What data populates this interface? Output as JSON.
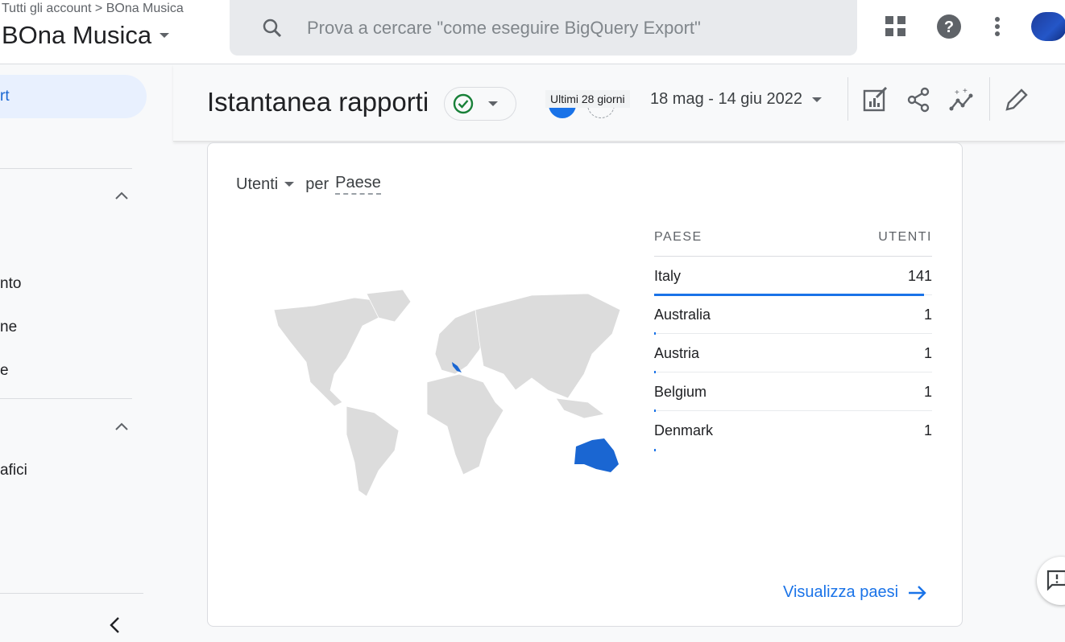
{
  "header": {
    "breadcrumb": "Tutti gli account > BOna Musica",
    "property_name": "BOna Musica",
    "search_placeholder": "Prova a cercare \"come eseguire BigQuery Export\"",
    "icons": [
      "apps-icon",
      "help-icon",
      "more-vert-icon",
      "account-avatar"
    ]
  },
  "sidebar": {
    "items": [
      {
        "label": "rt",
        "active": true
      },
      {
        "label": "nto"
      },
      {
        "label": "ne"
      },
      {
        "label": "e"
      },
      {
        "label": "afici"
      }
    ]
  },
  "toolbar": {
    "title": "Istantanea rapporti",
    "date_chip": "Ultimi 28 giorni",
    "date_range": "18 mag - 14 giu 2022",
    "icons": [
      "customize-report-icon",
      "share-icon",
      "insights-icon",
      "edit-icon"
    ]
  },
  "card": {
    "metric": "Utenti",
    "per": "per",
    "dimension": "Paese",
    "columns": [
      "PAESE",
      "UTENTI"
    ],
    "rows": [
      {
        "country": "Italy",
        "users": "141",
        "share": 1.0
      },
      {
        "country": "Australia",
        "users": "1",
        "share": 0.007
      },
      {
        "country": "Austria",
        "users": "1",
        "share": 0.007
      },
      {
        "country": "Belgium",
        "users": "1",
        "share": 0.007
      },
      {
        "country": "Denmark",
        "users": "1",
        "share": 0.007
      }
    ],
    "view_link": "Visualizza paesi",
    "colors": {
      "accent": "#1a73e8",
      "map_land": "#dcdcdc",
      "map_highlight": "#1a66d2"
    }
  }
}
